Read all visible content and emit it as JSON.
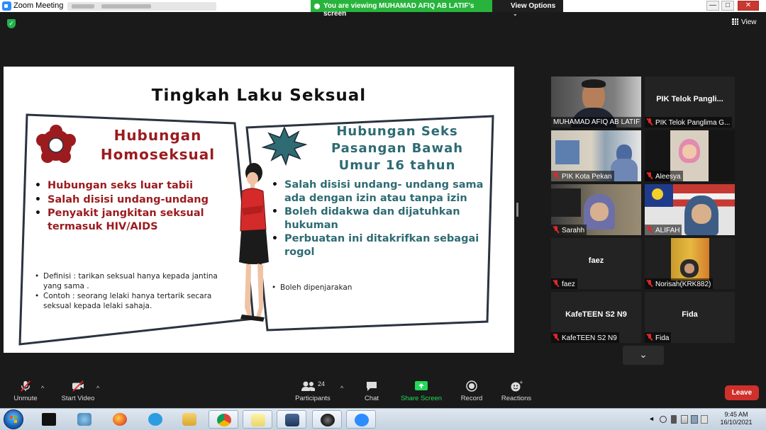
{
  "window": {
    "title": "Zoom Meeting",
    "viewing_banner": "You are viewing MUHAMAD AFIQ AB LATIF's screen",
    "view_options": "View Options",
    "view_options_icon": "chevron-down-icon",
    "controls": {
      "minimize": "—",
      "maximize": "□",
      "close": "✕"
    }
  },
  "meeting": {
    "view_label": "View",
    "security_icon": "shield-check-icon"
  },
  "slide": {
    "title": "Tingkah Laku Seksual",
    "left": {
      "heading_line1": "Hubungan",
      "heading_line2": "Homoseksual",
      "bullets": [
        "Hubungan seks luar tabii",
        "Salah disisi undang-undang",
        "Penyakit jangkitan seksual termasuk HIV/AIDS"
      ],
      "notes": [
        "Definisi : tarikan seksual hanya kepada jantina yang sama .",
        "Contoh : seorang lelaki hanya tertarik secara seksual kepada lelaki sahaja."
      ]
    },
    "right": {
      "heading_line1": "Hubungan Seks",
      "heading_line2": "Pasangan Bawah",
      "heading_line3": "Umur 16 tahun",
      "bullets": [
        "Salah disisi undang- undang sama ada dengan izin atau tanpa izin",
        "Boleh didakwa dan dijatuhkan hukuman",
        "Perbuatan ini ditakrifkan sebagai rogol"
      ],
      "notes": [
        "Boleh dipenjarakan"
      ]
    }
  },
  "participants_gallery": [
    {
      "name": "MUHAMAD AFIQ AB LATIF",
      "muted": false,
      "video": true,
      "active": true
    },
    {
      "name": "PIK Telok Panglima G...",
      "center": "PIK Telok Pangli...",
      "muted": true,
      "video": false
    },
    {
      "name": "PIK Kota Pekan",
      "muted": true,
      "video": true
    },
    {
      "name": "Aleesya",
      "muted": true,
      "video": true
    },
    {
      "name": "Sarahh",
      "muted": true,
      "video": true
    },
    {
      "name": "ALIFAH",
      "muted": true,
      "video": true
    },
    {
      "name": "faez",
      "center": "faez",
      "muted": true,
      "video": false
    },
    {
      "name": "Norisah(KRK882)",
      "muted": true,
      "video": true
    },
    {
      "name": "KafeTEEN S2 N9",
      "center": "KafeTEEN S2 N9",
      "muted": true,
      "video": false
    },
    {
      "name": "Fida",
      "center": "Fida",
      "muted": true,
      "video": false
    }
  ],
  "toolbar": {
    "unmute": "Unmute",
    "start_video": "Start Video",
    "participants": "Participants",
    "participants_count": "24",
    "chat": "Chat",
    "share_screen": "Share Screen",
    "record": "Record",
    "reactions": "Reactions",
    "leave": "Leave",
    "colors": {
      "share_screen": "#23d959",
      "leave": "#d0302c"
    }
  },
  "taskbar": {
    "time": "9:45 AM",
    "date": "16/10/2021"
  }
}
